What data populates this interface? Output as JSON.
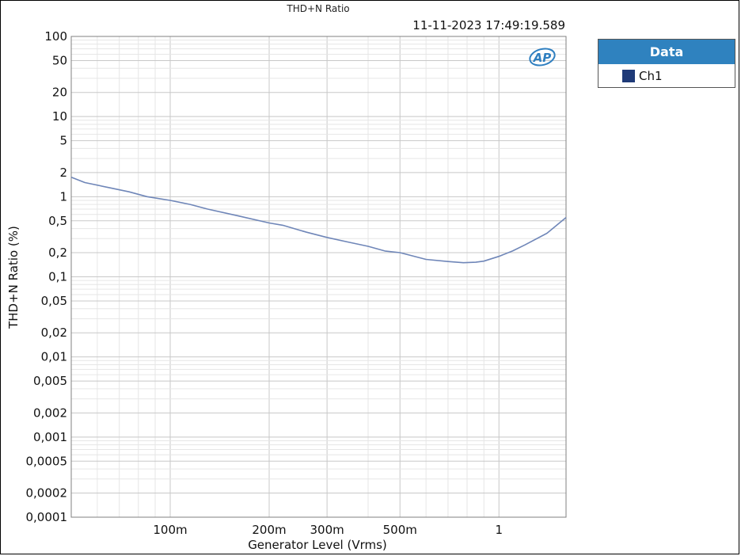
{
  "chart_data": {
    "type": "line",
    "title": "THD+N Ratio",
    "timestamp": "11-11-2023 17:49:19.589",
    "xlabel": "Generator Level (Vrms)",
    "ylabel": "THD+N Ratio (%)",
    "x_scale": "log",
    "y_scale": "log",
    "xlim": [
      0.05,
      1.6
    ],
    "ylim": [
      0.0001,
      100
    ],
    "grid": true,
    "x_ticks": [
      {
        "value": 0.1,
        "label": "100m"
      },
      {
        "value": 0.2,
        "label": "200m"
      },
      {
        "value": 0.3,
        "label": "300m"
      },
      {
        "value": 0.5,
        "label": "500m"
      },
      {
        "value": 1,
        "label": "1"
      }
    ],
    "y_ticks": [
      {
        "value": 100,
        "label": "100"
      },
      {
        "value": 50,
        "label": "50"
      },
      {
        "value": 20,
        "label": "20"
      },
      {
        "value": 10,
        "label": "10"
      },
      {
        "value": 5,
        "label": "5"
      },
      {
        "value": 2,
        "label": "2"
      },
      {
        "value": 1,
        "label": "1"
      },
      {
        "value": 0.5,
        "label": "0,5"
      },
      {
        "value": 0.2,
        "label": "0,2"
      },
      {
        "value": 0.1,
        "label": "0,1"
      },
      {
        "value": 0.05,
        "label": "0,05"
      },
      {
        "value": 0.02,
        "label": "0,02"
      },
      {
        "value": 0.01,
        "label": "0,01"
      },
      {
        "value": 0.005,
        "label": "0,005"
      },
      {
        "value": 0.002,
        "label": "0,002"
      },
      {
        "value": 0.001,
        "label": "0,001"
      },
      {
        "value": 0.0005,
        "label": "0,0005"
      },
      {
        "value": 0.0002,
        "label": "0,0002"
      },
      {
        "value": 0.0001,
        "label": "0,0001"
      }
    ],
    "legend": {
      "title": "Data",
      "position": "right"
    },
    "series": [
      {
        "name": "Ch1",
        "legend_color": "#1f3a78",
        "line_color": "#6f86b8",
        "x": [
          0.05,
          0.055,
          0.065,
          0.075,
          0.085,
          0.1,
          0.115,
          0.13,
          0.16,
          0.2,
          0.22,
          0.26,
          0.3,
          0.35,
          0.4,
          0.45,
          0.5,
          0.6,
          0.7,
          0.78,
          0.85,
          0.9,
          1.0,
          1.1,
          1.2,
          1.4,
          1.6
        ],
        "y": [
          1.75,
          1.5,
          1.3,
          1.15,
          1.0,
          0.9,
          0.8,
          0.7,
          0.58,
          0.47,
          0.44,
          0.36,
          0.31,
          0.27,
          0.24,
          0.21,
          0.2,
          0.165,
          0.155,
          0.15,
          0.152,
          0.157,
          0.18,
          0.21,
          0.25,
          0.35,
          0.55
        ]
      }
    ]
  },
  "logo": {
    "text": "AP",
    "color": "#2f7fc0"
  }
}
